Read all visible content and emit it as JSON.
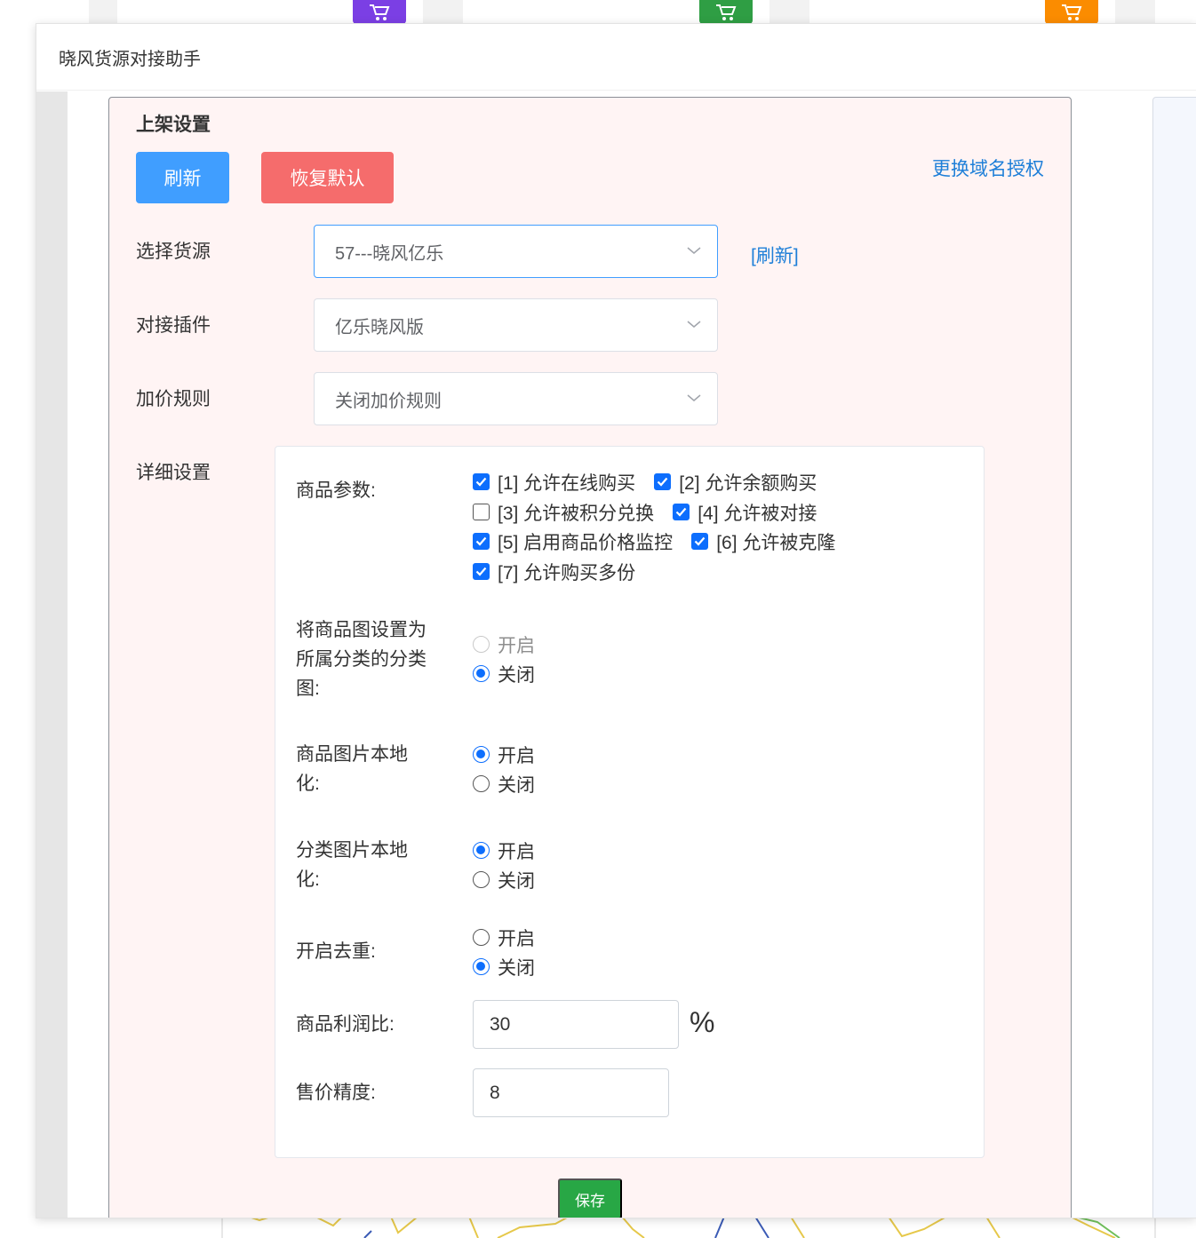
{
  "modal": {
    "title": "晓风货源对接助手"
  },
  "card": {
    "title": "上架设置",
    "refresh_button": "刷新",
    "restore_button": "恢复默认",
    "change_domain_link": "更换域名授权"
  },
  "source": {
    "label": "选择货源",
    "value": "57---晓风亿乐",
    "refresh_link": "[刷新]"
  },
  "plugin": {
    "label": "对接插件",
    "value": "亿乐晓风版"
  },
  "price_rule": {
    "label": "加价规则",
    "value": "关闭加价规则"
  },
  "details": {
    "label": "详细设置",
    "product_params": {
      "label": "商品参数:",
      "options": [
        {
          "text": "[1] 允许在线购买",
          "checked": true
        },
        {
          "text": "[2] 允许余额购买",
          "checked": true
        },
        {
          "text": "[3] 允许被积分兑换",
          "checked": false
        },
        {
          "text": "[4] 允许被对接",
          "checked": true
        },
        {
          "text": "[5] 启用商品价格监控",
          "checked": true
        },
        {
          "text": "[6] 允许被克隆",
          "checked": true
        },
        {
          "text": "[7] 允许购买多份",
          "checked": true
        }
      ]
    },
    "category_image": {
      "label_line1": "将商品图设置为",
      "label_line2": "所属分类的分类",
      "label_line3": "图:",
      "on": "开启",
      "off": "关闭",
      "selected": "off"
    },
    "product_image_local": {
      "label_line1": "商品图片本地",
      "label_line2": "化:",
      "on": "开启",
      "off": "关闭",
      "selected": "on"
    },
    "category_image_local": {
      "label_line1": "分类图片本地",
      "label_line2": "化:",
      "on": "开启",
      "off": "关闭",
      "selected": "on"
    },
    "dedupe": {
      "label": "开启去重:",
      "on": "开启",
      "off": "关闭",
      "selected": "off"
    },
    "profit_ratio": {
      "label": "商品利润比:",
      "value": "30",
      "unit": "%"
    },
    "price_precision": {
      "label": "售价精度:",
      "value": "8"
    }
  },
  "save_button": "保存",
  "colors": {
    "primary": "#409eff",
    "danger": "#f56c6c",
    "success": "#28a745",
    "checkbox": "#0d6efd"
  },
  "icons": {
    "cart": "shopping-cart-icon",
    "chevron": "chevron-down-icon"
  }
}
